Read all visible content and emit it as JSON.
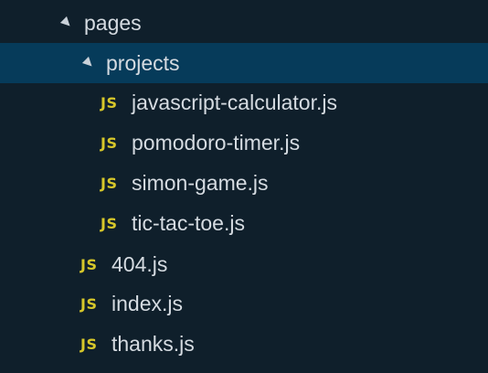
{
  "tree": {
    "pages": {
      "label": "pages",
      "twisty": "chevron-down-icon"
    },
    "projects": {
      "label": "projects",
      "twisty": "chevron-down-icon",
      "selected": true
    },
    "files": [
      {
        "icon_text": "JS",
        "label": "javascript-calculator.js"
      },
      {
        "icon_text": "JS",
        "label": "pomodoro-timer.js"
      },
      {
        "icon_text": "JS",
        "label": "simon-game.js"
      },
      {
        "icon_text": "JS",
        "label": "tic-tac-toe.js"
      },
      {
        "icon_text": "JS",
        "label": "404.js"
      },
      {
        "icon_text": "JS",
        "label": "index.js"
      },
      {
        "icon_text": "JS",
        "label": "thanks.js"
      }
    ]
  },
  "colors": {
    "background": "#0f1f2b",
    "selection": "#063b5a",
    "js_icon": "#d7c72a",
    "text": "#d5dbe1"
  }
}
